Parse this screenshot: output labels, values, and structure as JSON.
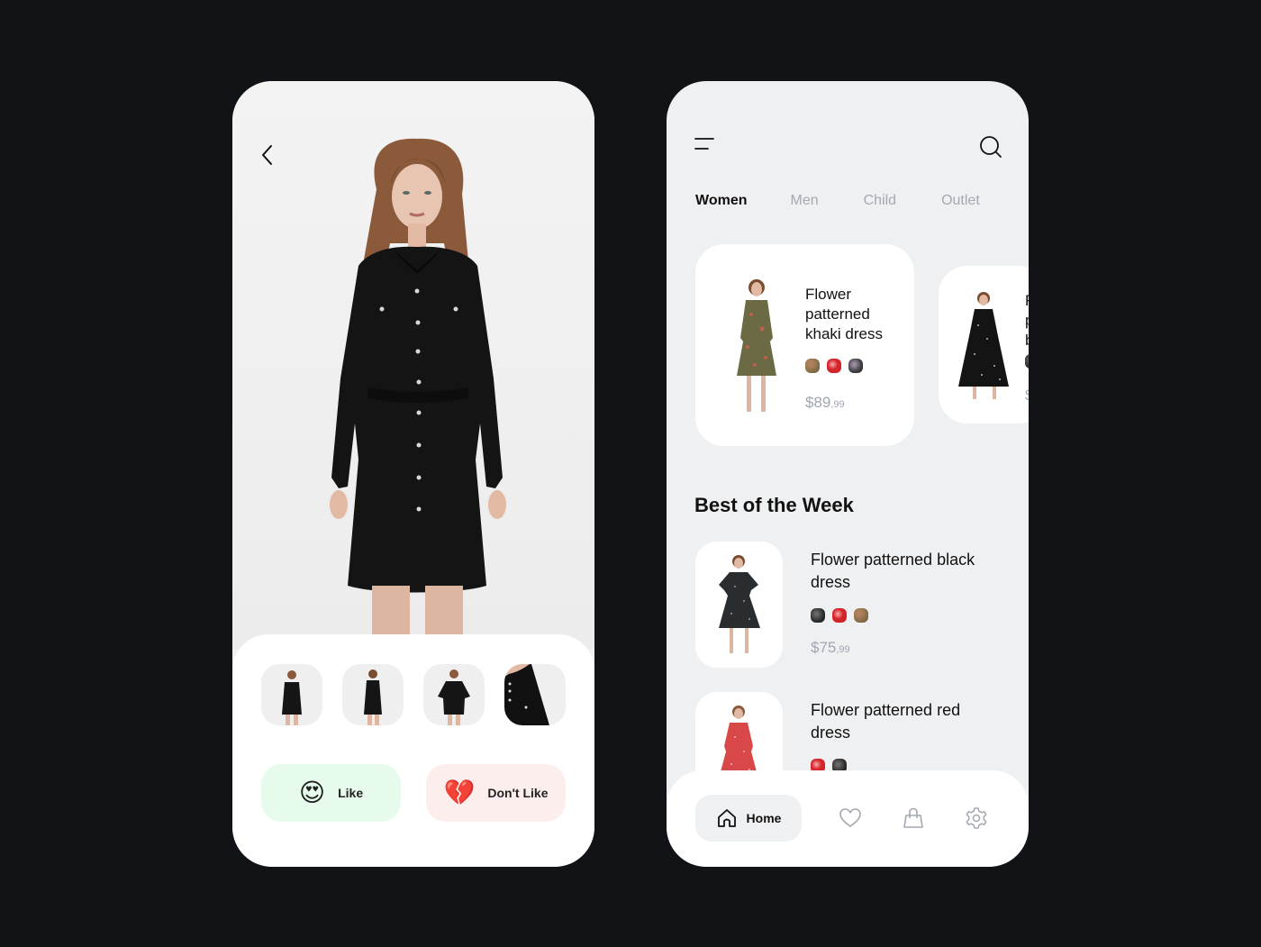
{
  "product_detail": {
    "back_icon": "chevron-left-icon",
    "hero_image": "woman in black long-sleeve button-front shirt dress",
    "thumbnails": [
      {
        "label": "front view"
      },
      {
        "label": "back view"
      },
      {
        "label": "pose view"
      },
      {
        "label": "close-up detail"
      }
    ],
    "like_button": {
      "emoji": "😍",
      "label": "Like",
      "color": "#e6fbeb"
    },
    "dislike_button": {
      "emoji": "💔",
      "label": "Don't Like",
      "color": "#fdeeee"
    }
  },
  "shop_home": {
    "menu_icon": "hamburger-menu-icon",
    "search_icon": "search-icon",
    "tabs": [
      {
        "label": "Women",
        "active": true
      },
      {
        "label": "Men",
        "active": false
      },
      {
        "label": "Child",
        "active": false
      },
      {
        "label": "Outlet",
        "active": false
      }
    ],
    "featured": [
      {
        "title": "Flower patterned khaki dress",
        "swatches": [
          "khaki",
          "red",
          "dark"
        ],
        "price_main": "$89",
        "price_cents": ",99"
      },
      {
        "title": "Flower patterned black dress",
        "swatches": [
          "black"
        ],
        "price_main": "$",
        "price_cents": ""
      }
    ],
    "section_title": "Best of the Week",
    "best_of_week": [
      {
        "title": "Flower patterned black dress",
        "swatches": [
          "black",
          "red",
          "khaki"
        ],
        "price_main": "$75",
        "price_cents": ",99"
      },
      {
        "title": "Flower patterned red dress",
        "swatches": [
          "red",
          "black"
        ]
      }
    ],
    "bottom_nav": [
      {
        "label": "Home",
        "icon": "home-icon",
        "active": true
      },
      {
        "label": "",
        "icon": "heart-icon",
        "active": false
      },
      {
        "label": "",
        "icon": "shopping-bag-icon",
        "active": false
      },
      {
        "label": "",
        "icon": "gear-icon",
        "active": false
      }
    ]
  },
  "colors": {
    "background": "#121316",
    "active_text": "#111111",
    "inactive_tab": "#a4a8b0",
    "price": "#a0a6b0",
    "right_phone_bg": "#eff0f2"
  }
}
